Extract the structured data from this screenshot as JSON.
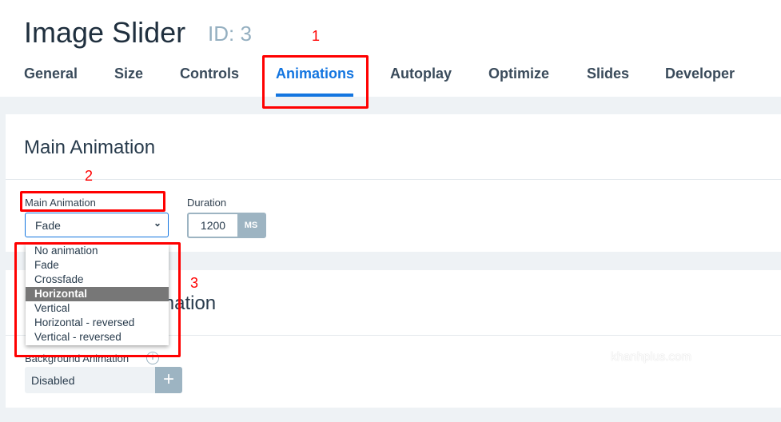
{
  "header": {
    "title": "Image Slider",
    "id_label": "ID: 3",
    "tabs": [
      {
        "label": "General"
      },
      {
        "label": "Size"
      },
      {
        "label": "Controls"
      },
      {
        "label": "Animations",
        "active": true
      },
      {
        "label": "Autoplay"
      },
      {
        "label": "Optimize"
      },
      {
        "label": "Slides"
      },
      {
        "label": "Developer"
      }
    ]
  },
  "main_card": {
    "title": "Main Animation",
    "main_animation_label": "Main Animation",
    "main_animation_value": "Fade",
    "duration_label": "Duration",
    "duration_value": "1200",
    "duration_unit": "MS",
    "options": [
      "No animation",
      "Fade",
      "Crossfade",
      "Horizontal",
      "Vertical",
      "Horizontal - reversed",
      "Vertical - reversed"
    ],
    "highlighted_option": "Horizontal"
  },
  "bg_card": {
    "title": "Background Animation",
    "bg_animation_label": "Background Animation",
    "bg_animation_value": "Disabled",
    "add_label": "+",
    "info": "i"
  },
  "annotations": [
    "1",
    "2",
    "3"
  ],
  "watermark": "khanhplus.com",
  "colors": {
    "accent": "#1375e0",
    "annotation": "#ff0000"
  }
}
